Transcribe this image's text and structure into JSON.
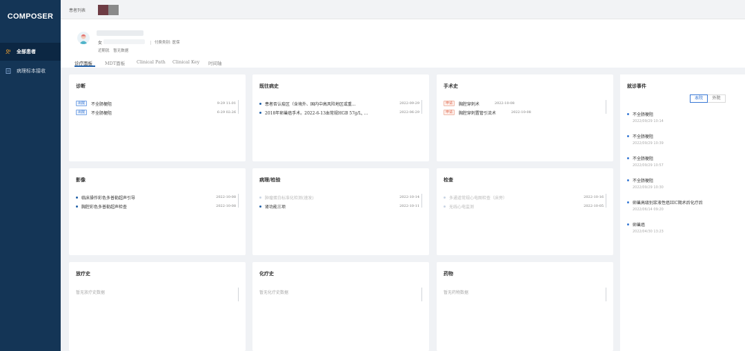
{
  "app": {
    "logo": "COMPOSER"
  },
  "sidebar": {
    "items": [
      {
        "label": "全部患者",
        "active": true
      },
      {
        "label": "病理标本接收",
        "active": false
      }
    ]
  },
  "topbar": {
    "tab_label": "患者列表",
    "swatch_colors": [
      "#6e3c44",
      "#8a8a8a"
    ]
  },
  "patient": {
    "gender": "女",
    "payment": "付费类别: 医保",
    "tags": [
      "近期就",
      "暂无数据"
    ]
  },
  "tabs": [
    "诊疗面板",
    "MDT面板",
    "Clinical Path",
    "Clinical Key",
    "时间轴"
  ],
  "cards": {
    "diagnosis": {
      "title": "诊断",
      "rows": [
        {
          "badge": "出院",
          "text": "不全肠梗阻",
          "date": "9-29 11:01"
        },
        {
          "badge": "出院",
          "text": "不全肠梗阻",
          "date": "6-29 02:26"
        }
      ]
    },
    "history": {
      "title": "既往病史",
      "rows": [
        {
          "text": "患者否认疫区（含境外、国内中高风险地区或重...",
          "date": "2022-09-29"
        },
        {
          "text": "2018年卵巢癌手术。2022-6-13血常规HGB 57g/L, ...",
          "date": "2022-06-29"
        }
      ]
    },
    "surgery": {
      "title": "手术史",
      "rows": [
        {
          "badge": "申请",
          "text": "胸腔穿刺术",
          "date": "2022-10-08"
        },
        {
          "badge": "申请",
          "text": "胸腔穿刺置管引流术",
          "date": "2022-10-08"
        }
      ]
    },
    "imaging": {
      "title": "影像",
      "rows": [
        {
          "text": "临床操作彩色多普勒超声引导",
          "date": "2022-10-08"
        },
        {
          "text": "胸腔彩色多普勒超声检查",
          "date": "2022-10-08"
        }
      ]
    },
    "pathology": {
      "title": "病理/检验",
      "rows": [
        {
          "text": "肿瘤蛋白标准化检测(速发)",
          "date": "2022-10-14",
          "faint": true
        },
        {
          "text": "肾功能三项",
          "date": "2022-10-11",
          "faint": false
        }
      ]
    },
    "exam": {
      "title": "检查",
      "rows": [
        {
          "text": "多通道常规心电图检查（床旁）",
          "date": "2022-10-16",
          "faint": true
        },
        {
          "text": "无线心电监测",
          "date": "2022-10-05",
          "faint": true
        }
      ]
    },
    "radiotherapy": {
      "title": "放疗史",
      "empty": "暂无放疗史数据"
    },
    "chemotherapy": {
      "title": "化疗史",
      "empty": "暂无化疗史数据"
    },
    "medication": {
      "title": "药物",
      "empty": "暂无药物数据"
    }
  },
  "events": {
    "title": "就诊事件",
    "toggle": {
      "on": "本院",
      "off": "外院"
    },
    "items": [
      {
        "title": "不全肠梗阻",
        "time": "2022/09/29 10:14"
      },
      {
        "title": "不全肠梗阻",
        "time": "2022/09/29 10:39"
      },
      {
        "title": "不全肠梗阻",
        "time": "2022/09/29 10:57"
      },
      {
        "title": "不全肠梗阻",
        "time": "2022/09/29 10:30"
      },
      {
        "title": "卵巢高级别浆液性癌IIIC期术后化疗后",
        "time": "2022/06/14 09:20"
      },
      {
        "title": "卵巢癌",
        "time": "2022/04/30 13:23"
      }
    ]
  }
}
